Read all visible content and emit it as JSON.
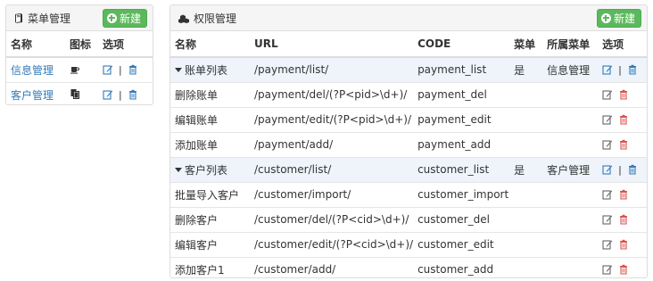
{
  "menu_panel": {
    "title": "菜单管理",
    "new_label": "新建",
    "columns": [
      "名称",
      "图标",
      "选项"
    ],
    "rows": [
      {
        "name": "信息管理",
        "icon": "coffee-icon"
      },
      {
        "name": "客户管理",
        "icon": "copy-icon"
      }
    ]
  },
  "perm_panel": {
    "title": "权限管理",
    "new_label": "新建",
    "columns": [
      "名称",
      "URL",
      "CODE",
      "菜单",
      "所属菜单",
      "选项"
    ],
    "rows": [
      {
        "name": "账单列表",
        "url": "/payment/list/",
        "code": "payment_list",
        "menu": "是",
        "parent": "信息管理"
      },
      {
        "name": "删除账单",
        "url": "/payment/del/(?P<pid>\\d+)/",
        "code": "payment_del",
        "menu": "",
        "parent": ""
      },
      {
        "name": "编辑账单",
        "url": "/payment/edit/(?P<pid>\\d+)/",
        "code": "payment_edit",
        "menu": "",
        "parent": ""
      },
      {
        "name": "添加账单",
        "url": "/payment/add/",
        "code": "payment_add",
        "menu": "",
        "parent": ""
      },
      {
        "name": "客户列表",
        "url": "/customer/list/",
        "code": "customer_list",
        "menu": "是",
        "parent": "客户管理"
      },
      {
        "name": "批量导入客户",
        "url": "/customer/import/",
        "code": "customer_import",
        "menu": "",
        "parent": ""
      },
      {
        "name": "删除客户",
        "url": "/customer/del/(?P<cid>\\d+)/",
        "code": "customer_del",
        "menu": "",
        "parent": ""
      },
      {
        "name": "编辑客户",
        "url": "/customer/edit/(?P<cid>\\d+)/",
        "code": "customer_edit",
        "menu": "",
        "parent": ""
      },
      {
        "name": "添加客户1",
        "url": "/customer/add/",
        "code": "customer_add",
        "menu": "",
        "parent": ""
      }
    ]
  },
  "options": {
    "separator": "|"
  },
  "colors": {
    "success": "#5cb85c",
    "link": "#337ab7",
    "danger": "#d9534f",
    "highlight_row": "#eef4fa"
  }
}
